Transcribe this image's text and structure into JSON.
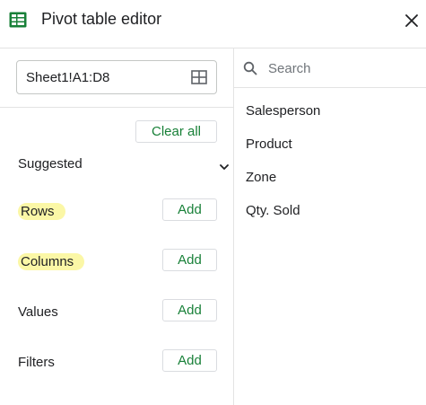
{
  "header": {
    "title": "Pivot table editor",
    "sheet_icon": "sheets-table-icon",
    "close_icon": "close-icon",
    "accent_color": "#188038"
  },
  "data_range": {
    "value": "Sheet1!A1:D8",
    "icon": "grid-select-icon"
  },
  "actions": {
    "clear_all": "Clear all"
  },
  "suggested": {
    "label": "Suggested",
    "icon": "chevron-down-icon"
  },
  "sections": [
    {
      "label": "Rows",
      "add_label": "Add",
      "highlighted": true
    },
    {
      "label": "Columns",
      "add_label": "Add",
      "highlighted": true
    },
    {
      "label": "Values",
      "add_label": "Add",
      "highlighted": false
    },
    {
      "label": "Filters",
      "add_label": "Add",
      "highlighted": false
    }
  ],
  "search": {
    "placeholder": "Search",
    "value": "",
    "icon": "search-icon"
  },
  "fields": [
    "Salesperson",
    "Product",
    "Zone",
    "Qty. Sold"
  ],
  "colors": {
    "highlight": "#fbf7a6",
    "button_text": "#188038",
    "sheets_green": "#188038"
  }
}
